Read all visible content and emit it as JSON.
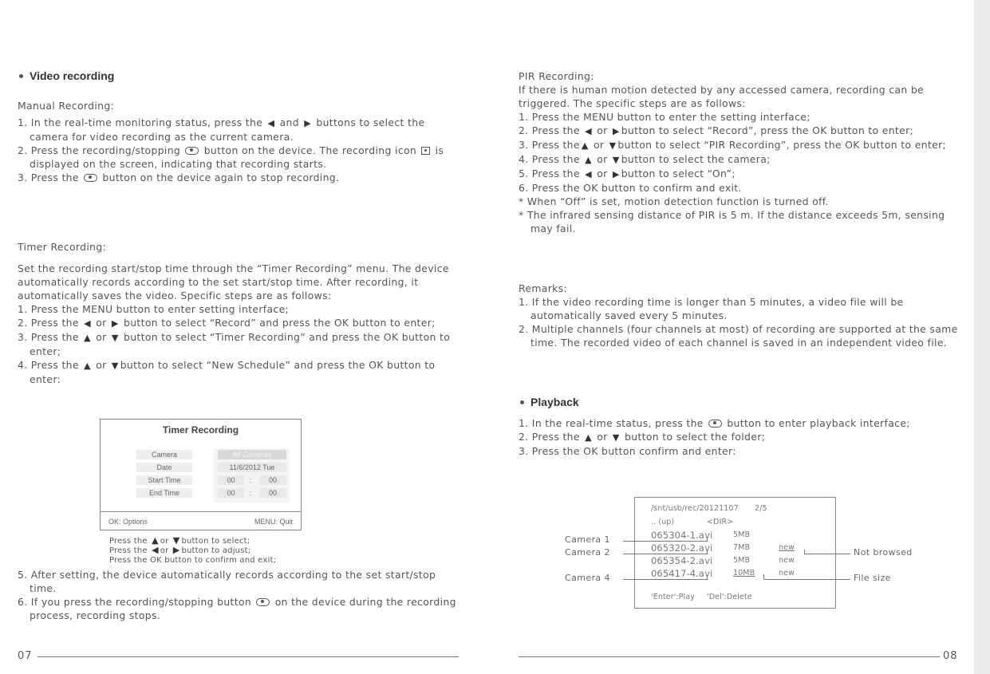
{
  "left": {
    "section_title": "Video recording",
    "manual": {
      "title": "Manual Recording:",
      "items": [
        {
          "parts": [
            "1. In the real-time monitoring status, press the ",
            {
              "icon": "left-arrow-icon"
            },
            " and ",
            {
              "icon": "right-arrow-icon"
            },
            " buttons to select the camera for video recording as the current camera."
          ]
        },
        {
          "parts": [
            "2. Press the recording/stopping ",
            {
              "icon": "record-button-icon"
            },
            " button on the device. The recording icon ",
            {
              "icon": "recording-indicator-icon"
            },
            " is displayed on the screen, indicating that recording starts."
          ]
        },
        {
          "parts": [
            "3. Press the ",
            {
              "icon": "record-button-icon"
            },
            " button on the device again to stop recording."
          ]
        }
      ]
    },
    "timer": {
      "title": "Timer Recording:",
      "intro": "Set the recording start/stop time through the “Timer Recording” menu. The device automatically records according to the set start/stop time. After recording, it automatically saves the video. Specific steps are as follows:",
      "items": [
        {
          "parts": [
            "1. Press the MENU button to enter setting interface;"
          ]
        },
        {
          "parts": [
            "2. Press the ",
            {
              "icon": "left-arrow-icon"
            },
            " or ",
            {
              "icon": "right-arrow-icon"
            },
            " button to select “Record” and press the OK button to enter;"
          ]
        },
        {
          "parts": [
            "3. Press the ",
            {
              "icon": "up-arrow-icon"
            },
            " or ",
            {
              "icon": "down-arrow-icon"
            },
            " button to select “Timer Recording” and press the OK button to enter;"
          ]
        },
        {
          "parts": [
            "4. Press the ",
            {
              "icon": "up-arrow-icon"
            },
            " or ",
            {
              "icon": "down-arrow-icon"
            },
            "button to select “New Schedule” and press the OK button to enter:"
          ]
        }
      ],
      "dialog": {
        "title": "Timer Recording",
        "labels": [
          "Camera",
          "Date",
          "Start Time",
          "End Time"
        ],
        "camera_value": "All Cameras",
        "date_value": "11/6/2012   Tue",
        "start_h": "00",
        "start_m": "00",
        "end_h": "00",
        "end_m": "00",
        "sep": ":",
        "ok": "OK: Options",
        "menu": "MENU: Quit"
      },
      "notes": [
        {
          "parts": [
            "Press the ",
            {
              "icon": "up-arrow-icon"
            },
            "or ",
            {
              "icon": "down-arrow-icon"
            },
            "button to select;"
          ]
        },
        {
          "parts": [
            "Press the ",
            {
              "icon": "left-arrow-icon"
            },
            "or ",
            {
              "icon": "right-arrow-icon"
            },
            "button to adjust;"
          ]
        },
        {
          "parts": [
            "Press the OK button to confirm and exit;"
          ]
        }
      ],
      "items2": [
        {
          "parts": [
            "5. After setting, the device automatically records according to the set start/stop time."
          ]
        },
        {
          "parts": [
            "6. If you press the recording/stopping button ",
            {
              "icon": "record-button-icon"
            },
            " on the device during the recording process, recording stops."
          ]
        }
      ]
    },
    "page_number": "07"
  },
  "right": {
    "pir": {
      "title": "PIR Recording:",
      "intro": "If there is human motion detected by any accessed camera, recording can be triggered. The specific steps are as follows:",
      "items": [
        {
          "parts": [
            "1. Press the MENU button to enter the setting interface;"
          ]
        },
        {
          "parts": [
            "2. Press the ",
            {
              "icon": "left-arrow-icon"
            },
            " or ",
            {
              "icon": "right-arrow-icon"
            },
            "button to select “Record”, press the OK button to enter;"
          ]
        },
        {
          "parts": [
            "3. Press the",
            {
              "icon": "up-arrow-icon"
            },
            " or ",
            {
              "icon": "down-arrow-icon"
            },
            "button to select “PIR Recording”, press the OK button to enter;"
          ]
        },
        {
          "parts": [
            "4. Press the ",
            {
              "icon": "up-arrow-icon"
            },
            " or ",
            {
              "icon": "down-arrow-icon"
            },
            "button to select the camera;"
          ]
        },
        {
          "parts": [
            "5. Press the ",
            {
              "icon": "left-arrow-icon"
            },
            " or ",
            {
              "icon": "right-arrow-icon"
            },
            "button to select “On”;"
          ]
        },
        {
          "parts": [
            "6. Press the OK button to confirm and exit."
          ]
        },
        {
          "parts": [
            "* When “Off” is set, motion detection function is turned off."
          ]
        },
        {
          "parts": [
            "* The infrared sensing distance of PIR is 5 m. If the distance exceeds 5m, sensing may fail."
          ]
        }
      ]
    },
    "remarks": {
      "title": "Remarks:",
      "items": [
        {
          "parts": [
            "1. If the video recording time is longer than 5 minutes, a video file will be automatically saved every 5 minutes."
          ]
        },
        {
          "parts": [
            "2. Multiple channels (four channels at most) of recording are supported at the same time. The recorded video of each channel is saved in an independent video file."
          ]
        }
      ]
    },
    "playback": {
      "section_title": "Playback",
      "items": [
        {
          "parts": [
            "1. In the real-time status, press the ",
            {
              "icon": "playback-button-icon"
            },
            " button to enter playback interface;"
          ]
        },
        {
          "parts": [
            "2. Press the ",
            {
              "icon": "up-arrow-icon"
            },
            " or ",
            {
              "icon": "down-arrow-icon"
            },
            " button to select the folder;"
          ]
        },
        {
          "parts": [
            "3. Press the OK button confirm and enter:"
          ]
        }
      ],
      "screen": {
        "path": "/snt/usb/rec/20121107",
        "page": "2/5",
        "up": "..  (up)",
        "dir": "<DIR>",
        "files": [
          {
            "name": "065304-1.avi",
            "size": "5MB",
            "status": ""
          },
          {
            "name": "065320-2.avi",
            "size": "7MB",
            "status": "new"
          },
          {
            "name": "065354-2.avi",
            "size": "5MB",
            "status": "new"
          },
          {
            "name": "065417-4.avi",
            "size": "10MB",
            "status": "new"
          }
        ],
        "hint_play": "'Enter':Play",
        "hint_del": "'Del':Delete"
      },
      "callouts": {
        "cam1": "Camera 1",
        "cam2": "Camera 2",
        "cam4": "Camera 4",
        "not_browsed": "Not browsed",
        "file_size": "File size"
      }
    },
    "page_number": "08"
  }
}
